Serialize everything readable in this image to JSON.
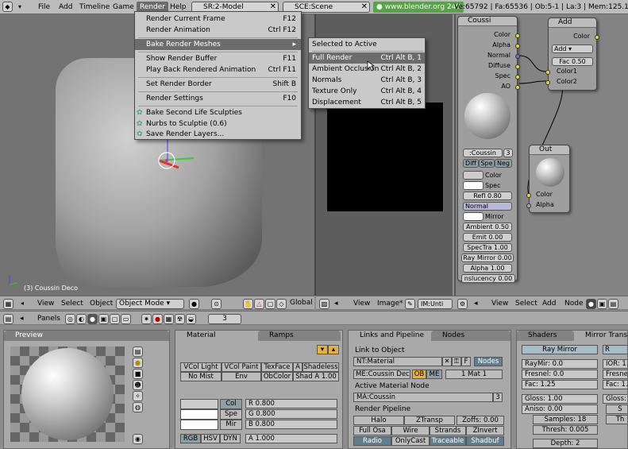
{
  "topbar": {
    "menus": [
      "File",
      "Add",
      "Timeline",
      "Game",
      "Render",
      "Help"
    ],
    "screen": "SR:2-Model",
    "scene": "SCE:Scene",
    "url": "www.blender.org 249",
    "stats": "Ve:65792 | Fa:65536 | Ob:5-1 | La:3 | Mem:125.17M ("
  },
  "render_menu": {
    "items": [
      {
        "label": "Render Current Frame",
        "shortcut": "F12"
      },
      {
        "label": "Render Animation",
        "shortcut": "Ctrl F12"
      },
      {
        "label": "Bake Render Meshes",
        "shortcut": "▸"
      },
      {
        "label": "Show Render Buffer",
        "shortcut": "F11"
      },
      {
        "label": "Play Back Rendered Animation",
        "shortcut": "Ctrl F11"
      },
      {
        "label": "Set Render Border",
        "shortcut": "Shift B"
      },
      {
        "label": "Render Settings",
        "shortcut": "F10"
      },
      {
        "label": "Bake Second Life Sculpties",
        "shortcut": ""
      },
      {
        "label": "Nurbs to Sculptie (0.6)",
        "shortcut": ""
      },
      {
        "label": "Save Render Layers...",
        "shortcut": ""
      }
    ]
  },
  "bake_submenu": {
    "items": [
      {
        "label": "Selected to Active",
        "shortcut": ""
      },
      {
        "label": "Full Render",
        "shortcut": "Ctrl Alt B, 1"
      },
      {
        "label": "Ambient Occlusion",
        "shortcut": "Ctrl Alt B, 2"
      },
      {
        "label": "Normals",
        "shortcut": "Ctrl Alt B, 3"
      },
      {
        "label": "Texture Only",
        "shortcut": "Ctrl Alt B, 4"
      },
      {
        "label": "Displacement",
        "shortcut": "Ctrl Alt B, 5"
      }
    ]
  },
  "viewport": {
    "object_label": "(3) Coussin Deco",
    "header": {
      "view": "View",
      "select": "Select",
      "object": "Object",
      "mode": "Object Mode",
      "orientation": "Global"
    }
  },
  "image_editor": {
    "header": {
      "view": "View",
      "image": "Image*",
      "image_name": "IM:Unti"
    }
  },
  "node_editor": {
    "header": {
      "view": "View",
      "select": "Select",
      "add": "Add",
      "node": "Node"
    },
    "material_node": {
      "title": "Coussi",
      "outputs": [
        "Color",
        "Alpha",
        "Normal",
        "Diffuse",
        "Spec",
        "AO"
      ],
      "material": ":Coussin",
      "users": "3",
      "toggles": [
        "Diff",
        "Spe",
        "Neg"
      ],
      "inputs": [
        "Color",
        "Spec",
        "Refl 0.80",
        "Normal",
        "Mirror",
        "Ambient 0.50",
        "Emit 0.00",
        "SpecTra 1.00",
        "Ray Mirror 0.00",
        "Alpha 1.00",
        "nslucency 0.00"
      ]
    },
    "add_node": {
      "title": "Add",
      "output": "Color",
      "mode": "Add",
      "fac": "Fac 0.50",
      "inputs": [
        "Color1",
        "Color2"
      ]
    },
    "out_node": {
      "title": "Out",
      "inputs": [
        "Color",
        "Alpha"
      ]
    }
  },
  "buttons_header": {
    "panels": "Panels",
    "frame": "3"
  },
  "preview": {
    "tab": "Preview"
  },
  "material_panel": {
    "tabs": [
      "Material",
      "Ramps"
    ],
    "row1": [
      "VCol Light",
      "VCol Paint",
      "TexFace",
      "A",
      "Shadeless"
    ],
    "row2": [
      "No Mist",
      "Env",
      "ObColor",
      "Shad A 1.00"
    ],
    "color_buttons": [
      "Col",
      "Spe",
      "Mir"
    ],
    "sliders": [
      "R 0.800",
      "G 0.800",
      "B 0.800",
      "A 1.000"
    ],
    "modes": [
      "RGB",
      "HSV",
      "DYN"
    ]
  },
  "links_panel": {
    "tabs": [
      "Links and Pipeline",
      "Nodes"
    ],
    "link_to_object": "Link to Object",
    "nt_material": "NT:Material",
    "f_btn": "F",
    "nodes_btn": "Nodes",
    "me_label": "ME:Coussin Deco",
    "ob": "OB",
    "me": "ME",
    "mat_count": "1 Mat 1",
    "active_node": "Active Material Node",
    "ma_label": "MA:Coussin",
    "ma_users": "3",
    "pipeline": "Render Pipeline",
    "pipe_rows": [
      [
        "Halo",
        "ZTransp",
        "Zoffs: 0.00"
      ],
      [
        "Full Osa",
        "Wire",
        "Strands",
        "ZInvert"
      ],
      [
        "Radio",
        "OnlyCast",
        "Traceable",
        "Shadbuf"
      ]
    ]
  },
  "shaders_panel": {
    "tabs": [
      "Shaders",
      "Mirror Transp"
    ],
    "ray_mirror": "Ray Mirror",
    "sliders": [
      "RayMir: 0.0",
      "Fresnel: 0.0",
      "Fac: 1.25",
      "Gloss: 1.00",
      "Aniso: 0.00",
      "Samples: 18",
      "Thresh: 0.005",
      "Depth: 2"
    ],
    "right": [
      "R",
      "IOR: 1.",
      "Fresne",
      "Fac: 1.",
      "Gloss:",
      "S",
      "Th"
    ]
  }
}
